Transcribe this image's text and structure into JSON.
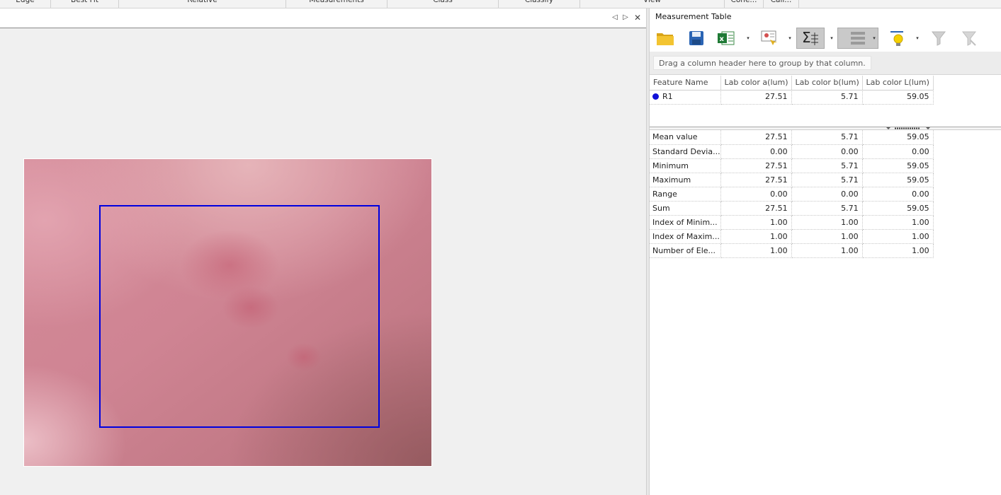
{
  "ribbon": {
    "groups": [
      "Edge",
      "Best Fit",
      "Relative",
      "Measurements",
      "Class",
      "Classify",
      "View",
      "Cone...",
      "Cali..."
    ]
  },
  "document": {
    "nav_prev": "◁",
    "nav_next": "▷",
    "close": "✕",
    "roi_color": "#0000e0"
  },
  "panel": {
    "title": "Measurement Table",
    "toolbar": [
      "open-folder-icon",
      "save-disk-icon",
      "excel-export-icon",
      "report-icon",
      "statistics-sigma-icon",
      "feature-list-icon",
      "highlight-bulb-icon",
      "filter-icon",
      "filter-clear-icon"
    ],
    "dropdown_glyph": "▾",
    "group_hint": "Drag a column header here to group by that column.",
    "columns": [
      "Feature Name",
      "Lab color a(lum)",
      "Lab color b(lum)",
      "Lab color L(lum)"
    ],
    "rows": [
      {
        "name": "R1",
        "a": "27.51",
        "b": "5.71",
        "L": "59.05",
        "marker_color": "#1010d8"
      }
    ],
    "stats": [
      {
        "name": "Mean value",
        "a": "27.51",
        "b": "5.71",
        "L": "59.05"
      },
      {
        "name": "Standard Devia...",
        "a": "0.00",
        "b": "0.00",
        "L": "0.00"
      },
      {
        "name": "Minimum",
        "a": "27.51",
        "b": "5.71",
        "L": "59.05"
      },
      {
        "name": "Maximum",
        "a": "27.51",
        "b": "5.71",
        "L": "59.05"
      },
      {
        "name": "Range",
        "a": "0.00",
        "b": "0.00",
        "L": "0.00"
      },
      {
        "name": "Sum",
        "a": "27.51",
        "b": "5.71",
        "L": "59.05"
      },
      {
        "name": "Index of Minim...",
        "a": "1.00",
        "b": "1.00",
        "L": "1.00"
      },
      {
        "name": "Index of Maxim...",
        "a": "1.00",
        "b": "1.00",
        "L": "1.00"
      },
      {
        "name": "Number of Ele...",
        "a": "1.00",
        "b": "1.00",
        "L": "1.00"
      }
    ]
  }
}
